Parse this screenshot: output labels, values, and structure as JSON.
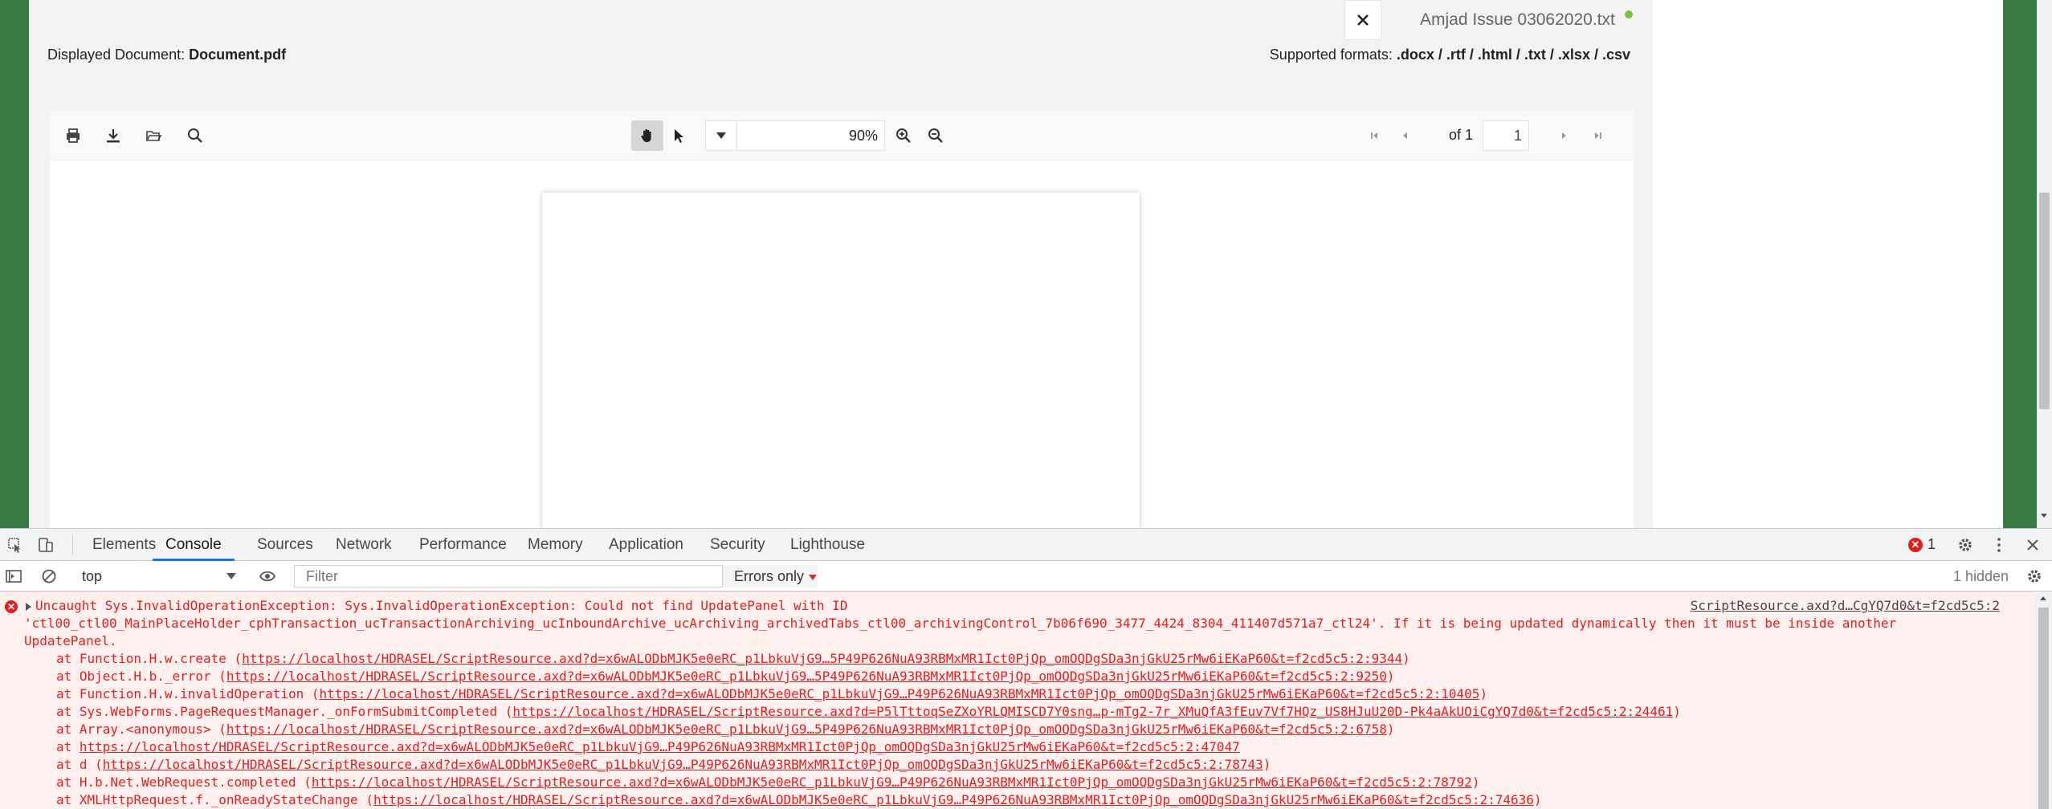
{
  "app": {
    "file_tab": "Amjad Issue 03062020.txt",
    "displayed_label": "Displayed Document:",
    "displayed_value": "Document.pdf",
    "formats_label": "Supported formats:",
    "formats_value": ".docx / .rtf / .html / .txt / .xlsx / .csv",
    "colors": {
      "green": "#3a7a45",
      "status_dot": "#7bc142"
    }
  },
  "viewer": {
    "zoom": "90%",
    "of_label": "of 1",
    "page_number": "1",
    "icons": [
      "print-icon",
      "download-icon",
      "open-folder-icon",
      "search-icon",
      "hand-tool-icon",
      "select-cursor-icon",
      "zoom-in-icon",
      "zoom-out-icon",
      "first-page-icon",
      "previous-page-icon",
      "next-page-icon",
      "last-page-icon"
    ]
  },
  "devtools": {
    "tabs": [
      "Elements",
      "Console",
      "Sources",
      "Network",
      "Performance",
      "Memory",
      "Application",
      "Security",
      "Lighthouse"
    ],
    "active_tab": "Console",
    "error_count": "1",
    "context": "top",
    "filter_placeholder": "Filter",
    "levels": "Errors only",
    "hidden": "1 hidden"
  },
  "console": {
    "message_line1": "Uncaught Sys.InvalidOperationException: Sys.InvalidOperationException: Could not find UpdatePanel with ID",
    "message_line2": "'ctl00_ctl00_MainPlaceHolder_cphTransaction_ucTransactionArchiving_ucInboundArchive_ucArchiving_archivedTabs_ctl00_archivingControl_7b06f690_3477_4424_8304_411407d571a7_ctl24'. If it is being updated dynamically then it must be inside another UpdatePanel.",
    "source": "ScriptResource.axd?d…CgYQ7d0&t=f2cd5c5:2",
    "stack": [
      {
        "prefix": "at Function.H.w.create (",
        "url": "https://localhost/HDRASEL/ScriptResource.axd?d=x6wALODbMJK5e0eRC_p1LbkuVjG9…5P49P626NuA93RBMxMR1Ict0PjQp_omOQDgSDa3njGkU25rMw6iEKaP60&t=f2cd5c5:2:9344",
        "suffix": ")"
      },
      {
        "prefix": "at Object.H.b._error (",
        "url": "https://localhost/HDRASEL/ScriptResource.axd?d=x6wALODbMJK5e0eRC_p1LbkuVjG9…5P49P626NuA93RBMxMR1Ict0PjQp_omOQDgSDa3njGkU25rMw6iEKaP60&t=f2cd5c5:2:9250",
        "suffix": ")"
      },
      {
        "prefix": "at Function.H.w.invalidOperation (",
        "url": "https://localhost/HDRASEL/ScriptResource.axd?d=x6wALODbMJK5e0eRC_p1LbkuVjG9…P49P626NuA93RBMxMR1Ict0PjQp_omOQDgSDa3njGkU25rMw6iEKaP60&t=f2cd5c5:2:10405",
        "suffix": ")"
      },
      {
        "prefix": "at Sys.WebForms.PageRequestManager._onFormSubmitCompleted (",
        "url": "https://localhost/HDRASEL/ScriptResource.axd?d=P5lTttoqSeZXoYRLQMISCD7Y0sng…p-mTg2-7r_XMuQfA3fEuv7Vf7HQz_US8HJuU20D-Pk4aAkUOiCgYQ7d0&t=f2cd5c5:2:24461",
        "suffix": ")"
      },
      {
        "prefix": "at Array.<anonymous> (",
        "url": "https://localhost/HDRASEL/ScriptResource.axd?d=x6wALODbMJK5e0eRC_p1LbkuVjG9…5P49P626NuA93RBMxMR1Ict0PjQp_omOQDgSDa3njGkU25rMw6iEKaP60&t=f2cd5c5:2:6758",
        "suffix": ")"
      },
      {
        "prefix": "at ",
        "url": "https://localhost/HDRASEL/ScriptResource.axd?d=x6wALODbMJK5e0eRC_p1LbkuVjG9…P49P626NuA93RBMxMR1Ict0PjQp_omOQDgSDa3njGkU25rMw6iEKaP60&t=f2cd5c5:2:47047",
        "suffix": ""
      },
      {
        "prefix": "at d (",
        "url": "https://localhost/HDRASEL/ScriptResource.axd?d=x6wALODbMJK5e0eRC_p1LbkuVjG9…P49P626NuA93RBMxMR1Ict0PjQp_omOQDgSDa3njGkU25rMw6iEKaP60&t=f2cd5c5:2:78743",
        "suffix": ")"
      },
      {
        "prefix": "at H.b.Net.WebRequest.completed (",
        "url": "https://localhost/HDRASEL/ScriptResource.axd?d=x6wALODbMJK5e0eRC_p1LbkuVjG9…P49P626NuA93RBMxMR1Ict0PjQp_omOQDgSDa3njGkU25rMw6iEKaP60&t=f2cd5c5:2:78792",
        "suffix": ")"
      },
      {
        "prefix": "at XMLHttpRequest.f._onReadyStateChange (",
        "url": "https://localhost/HDRASEL/ScriptResource.axd?d=x6wALODbMJK5e0eRC_p1LbkuVjG9…P49P626NuA93RBMxMR1Ict0PjQp_omOQDgSDa3njGkU25rMw6iEKaP60&t=f2cd5c5:2:74636",
        "suffix": ")"
      }
    ]
  }
}
